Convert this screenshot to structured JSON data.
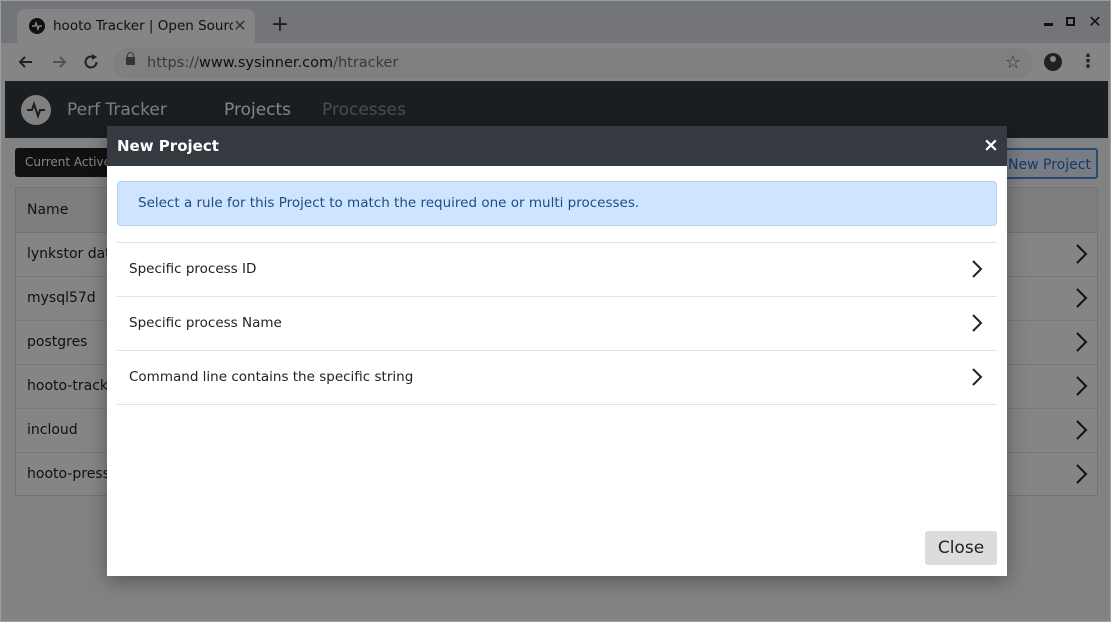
{
  "browser": {
    "tab_title": "hooto Tracker | Open Source",
    "tab_close": "✕",
    "new_tab": "+",
    "url_scheme": "https://",
    "url_domain": "www.sysinner.com",
    "url_path": "/htracker"
  },
  "app": {
    "brand": "Perf Tracker",
    "nav": {
      "projects": "Projects",
      "processes": "Processes"
    },
    "tooltip": "Current Active Projects",
    "new_project_button": "New Project",
    "table": {
      "header_name": "Name",
      "rows": [
        "lynkstor data",
        "mysql57d",
        "postgres",
        "hooto-tracker",
        "incloud",
        "hooto-press"
      ]
    }
  },
  "modal": {
    "title": "New Project",
    "close_icon": "×",
    "alert": "Select a rule for this Project to match the required one or multi processes.",
    "options": [
      "Specific process ID",
      "Specific process Name",
      "Command line contains the specific string"
    ],
    "close_button": "Close"
  },
  "colors": {
    "header_bg": "#343a40",
    "alert_bg": "#cfe5ff",
    "accent": "#1f6fd0"
  }
}
